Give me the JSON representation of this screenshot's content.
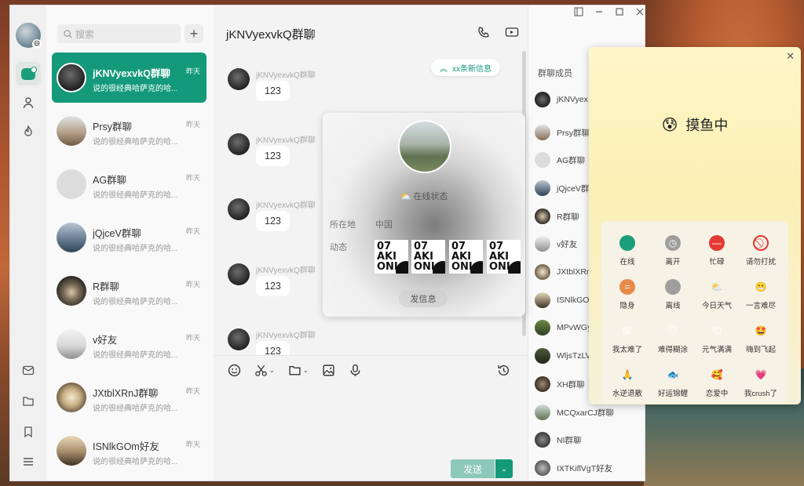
{
  "search": {
    "placeholder": "搜索"
  },
  "chat": {
    "title": "jKNVyexvkQ群聊",
    "new_messages": "xx条新信息"
  },
  "conversations": [
    {
      "name": "jKNVyexvkQ群聊",
      "time": "昨天",
      "preview": "说的很经典哈萨克的哈..."
    },
    {
      "name": "Prsy群聊",
      "time": "昨天",
      "preview": "说的很经典哈萨克的哈..."
    },
    {
      "name": "AG群聊",
      "time": "昨天",
      "preview": "说的很经典哈萨克的哈..."
    },
    {
      "name": "jQjceV群聊",
      "time": "昨天",
      "preview": "说的很经典哈萨克的哈..."
    },
    {
      "name": "R群聊",
      "time": "昨天",
      "preview": "说的很经典哈萨克的哈..."
    },
    {
      "name": "v好友",
      "time": "昨天",
      "preview": "说的很经典哈萨克的哈..."
    },
    {
      "name": "JXtblXRnJ群聊",
      "time": "昨天",
      "preview": "说的很经典哈萨克的哈..."
    },
    {
      "name": "ISNlkGOm好友",
      "time": "昨天",
      "preview": "说的很经典哈萨克的哈..."
    }
  ],
  "messages": [
    {
      "sender": "jKNVyexvkQ群聊",
      "text": "123"
    },
    {
      "sender": "jKNVyexvkQ群聊",
      "text": "123"
    },
    {
      "sender": "jKNVyexvkQ群聊",
      "text": "123"
    },
    {
      "sender": "jKNVyexvkQ群聊",
      "text": "123"
    },
    {
      "sender": "jKNVyexvkQ群聊",
      "text": "123"
    }
  ],
  "composer": {
    "send_label": "发送"
  },
  "members": {
    "title": "群聊成员",
    "items": [
      "jKNVyex",
      "Prsy群聊",
      "AG群聊",
      "jQjceV群",
      "R群聊",
      "v好友",
      "JXtblXRn",
      "ISNlkGO",
      "MPvWGy",
      "WljsTzLV",
      "XH群聊",
      "MCQxarCJ群聊",
      "NI群聊",
      "IXTKiflVgT好友"
    ]
  },
  "profile": {
    "status": "在线状态",
    "location_label": "所在地",
    "location_value": "中国",
    "moments_label": "动态",
    "tiles": [
      "07\nAKI\nONI",
      "07\nAKI\nONI",
      "07\nAKI\nONI",
      "07\nAKI\nONI"
    ],
    "send_message": "发信息"
  },
  "status_panel": {
    "current": "摸鱼中",
    "options": [
      "在线",
      "离开",
      "忙碌",
      "请勿打扰",
      "隐身",
      "离线",
      "今日天气",
      "一言难尽",
      "我太难了",
      "难得糊涂",
      "元气满满",
      "嗨到飞起",
      "水逆退散",
      "好运锦鲤",
      "恋爱中",
      "我crush了"
    ]
  },
  "colors": {
    "accent": "#14997a",
    "send_disabled": "#8cc9b8"
  }
}
